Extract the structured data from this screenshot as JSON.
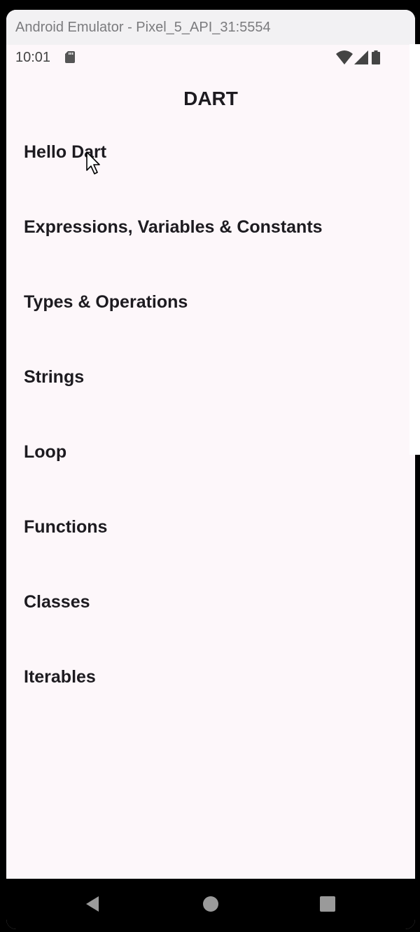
{
  "window": {
    "title": "Android Emulator - Pixel_5_API_31:5554"
  },
  "status_bar": {
    "time": "10:01",
    "icons": [
      "sd-card-icon",
      "wifi-icon",
      "signal-icon",
      "battery-icon"
    ]
  },
  "app_bar": {
    "title": "DART"
  },
  "menu": {
    "items": [
      {
        "label": "Hello Dart"
      },
      {
        "label": "Expressions, Variables & Constants"
      },
      {
        "label": "Types & Operations"
      },
      {
        "label": "Strings"
      },
      {
        "label": "Loop"
      },
      {
        "label": "Functions"
      },
      {
        "label": "Classes"
      },
      {
        "label": "Iterables"
      }
    ]
  },
  "nav_bar": {
    "buttons": [
      "back-icon",
      "home-icon",
      "recents-icon"
    ]
  },
  "colors": {
    "background": "#fdf7fa",
    "text": "#1d1b20",
    "titlebar": "#f2f1f3",
    "navbar": "#000000"
  }
}
